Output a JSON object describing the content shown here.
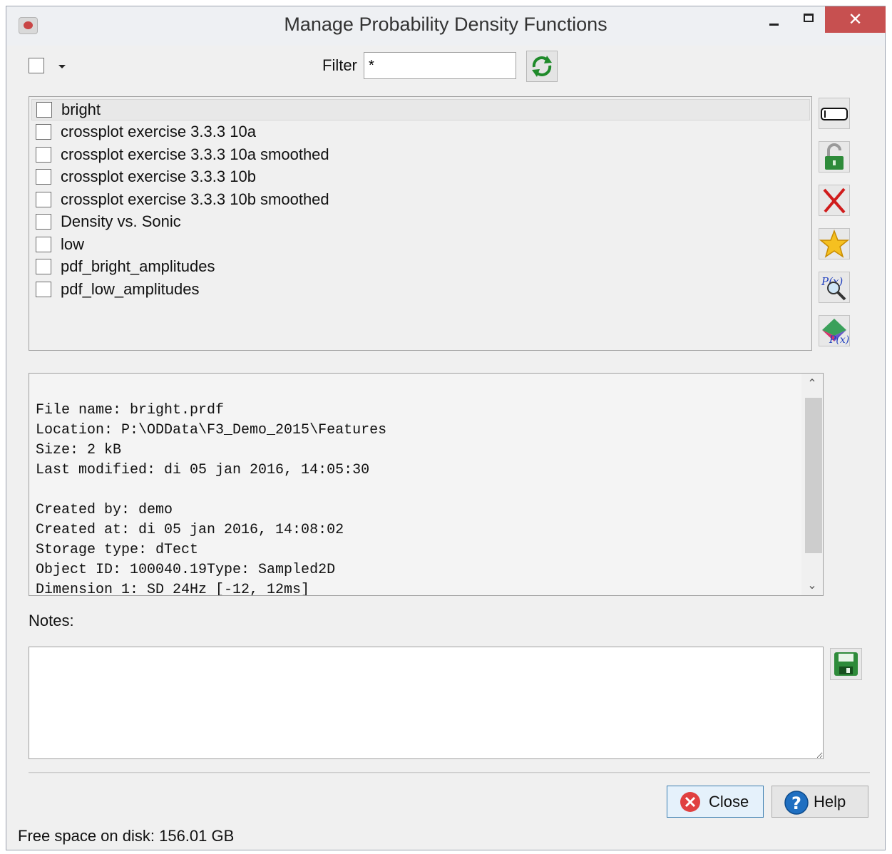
{
  "window": {
    "title": "Manage Probability Density Functions",
    "close_glyph": "✕"
  },
  "toolbar": {
    "filter_label": "Filter",
    "filter_value": "*"
  },
  "list": {
    "items": [
      {
        "label": "bright"
      },
      {
        "label": "crossplot exercise 3.3.3 10a"
      },
      {
        "label": "crossplot exercise 3.3.3 10a smoothed"
      },
      {
        "label": "crossplot exercise 3.3.3 10b"
      },
      {
        "label": "crossplot exercise 3.3.3 10b smoothed"
      },
      {
        "label": "Density vs. Sonic"
      },
      {
        "label": "low"
      },
      {
        "label": "pdf_bright_amplitudes"
      },
      {
        "label": "pdf_low_amplitudes"
      }
    ]
  },
  "side_buttons": [
    "rename-icon",
    "lock-icon",
    "delete-icon",
    "star-icon",
    "pdf-browse-icon",
    "pdf-create-icon"
  ],
  "info": {
    "text": "File name: bright.prdf\nLocation: P:\\ODData\\F3_Demo_2015\\Features\nSize: 2 kB\nLast modified: di 05 jan 2016, 14:05:30\n\nCreated by: demo\nCreated at: di 05 jan 2016, 14:08:02\nStorage type: dTect\nObject ID: 100040.19Type: Sampled2D\nDimension 1: SD 24Hz [-12, 12ms]"
  },
  "notes": {
    "label": "Notes:",
    "value": ""
  },
  "buttons": {
    "close_label": "Close",
    "help_label": "Help"
  },
  "footer": {
    "free_space": "Free space on disk: 156.01 GB"
  },
  "colors": {
    "close_button_bg": "#c75050",
    "accent_green": "#2e8b3a",
    "accent_red": "#d01c1c",
    "help_blue": "#1f6fc1"
  }
}
